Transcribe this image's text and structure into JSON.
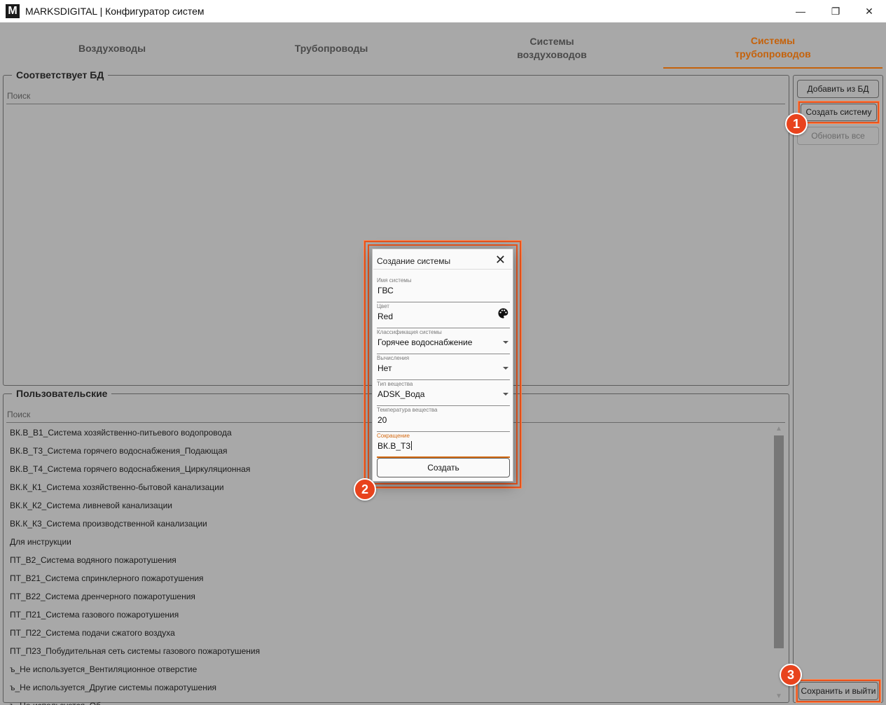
{
  "window": {
    "logo": "M",
    "title": "MARKSDIGITAL | Конфигуратор систем",
    "minimize": "—",
    "maximize": "❐",
    "close": "✕"
  },
  "tabs": [
    {
      "label": "Воздуховоды",
      "active": false
    },
    {
      "label": "Трубопроводы",
      "active": false
    },
    {
      "label": "Системы\nвоздуховодов",
      "active": false
    },
    {
      "label": "Системы\nтрубопроводов",
      "active": true
    }
  ],
  "db_group": {
    "title": "Соответствует БД",
    "search_placeholder": "Поиск"
  },
  "user_group": {
    "title": "Пользовательские",
    "search_placeholder": "Поиск",
    "items": [
      "ВК.В_В1_Система хозяйственно-питьевого водопровода",
      "ВК.В_Т3_Система горячего водоснабжения_Подающая",
      "ВК.В_Т4_Система горячего водоснабжения_Циркуляционная",
      "ВК.К_К1_Система хозяйственно-бытовой канализации",
      "ВК.К_К2_Система ливневой канализации",
      "ВК.К_К3_Система производственной канализации",
      "Для инструкции",
      "ПТ_В2_Система водяного пожаротушения",
      "ПТ_В21_Система спринклерного пожаротушения",
      "ПТ_В22_Система дренчерного пожаротушения",
      "ПТ_П21_Система газового пожаротушения",
      "ПТ_П22_Система подачи сжатого воздуха",
      "ПТ_П23_Побудительная сеть системы газового пожаротушения",
      "ъ_Не используется_Вентиляционное отверстие",
      "ъ_Не используется_Другие системы пожаротушения",
      "ъ_Не используется_Об..."
    ]
  },
  "side_buttons": {
    "add_from_db": "Добавить из БД",
    "create_system": "Создать систему",
    "refresh_all": "Обновить все",
    "save_exit": "Сохранить и выйти"
  },
  "badges": {
    "one": "1",
    "two": "2",
    "three": "3"
  },
  "dialog": {
    "title": "Создание системы",
    "close": "✕",
    "fields": {
      "name": {
        "label": "Имя системы",
        "value": "ГВС"
      },
      "color": {
        "label": "Цвет",
        "value": "Red"
      },
      "classification": {
        "label": "Классификация системы",
        "value": "Горячее водоснабжение"
      },
      "calculations": {
        "label": "Вычисления",
        "value": "Нет"
      },
      "fluid_type": {
        "label": "Тип вещества",
        "value": "ADSK_Вода"
      },
      "fluid_temp": {
        "label": "Температура вещества",
        "value": "20"
      },
      "abbreviation": {
        "label": "Сокращение",
        "value": "ВК.В_Т3"
      }
    },
    "create_button": "Создать"
  },
  "colors": {
    "accent": "#c5620b",
    "highlight": "#e8541d",
    "backdrop": "#a8a8a8"
  }
}
